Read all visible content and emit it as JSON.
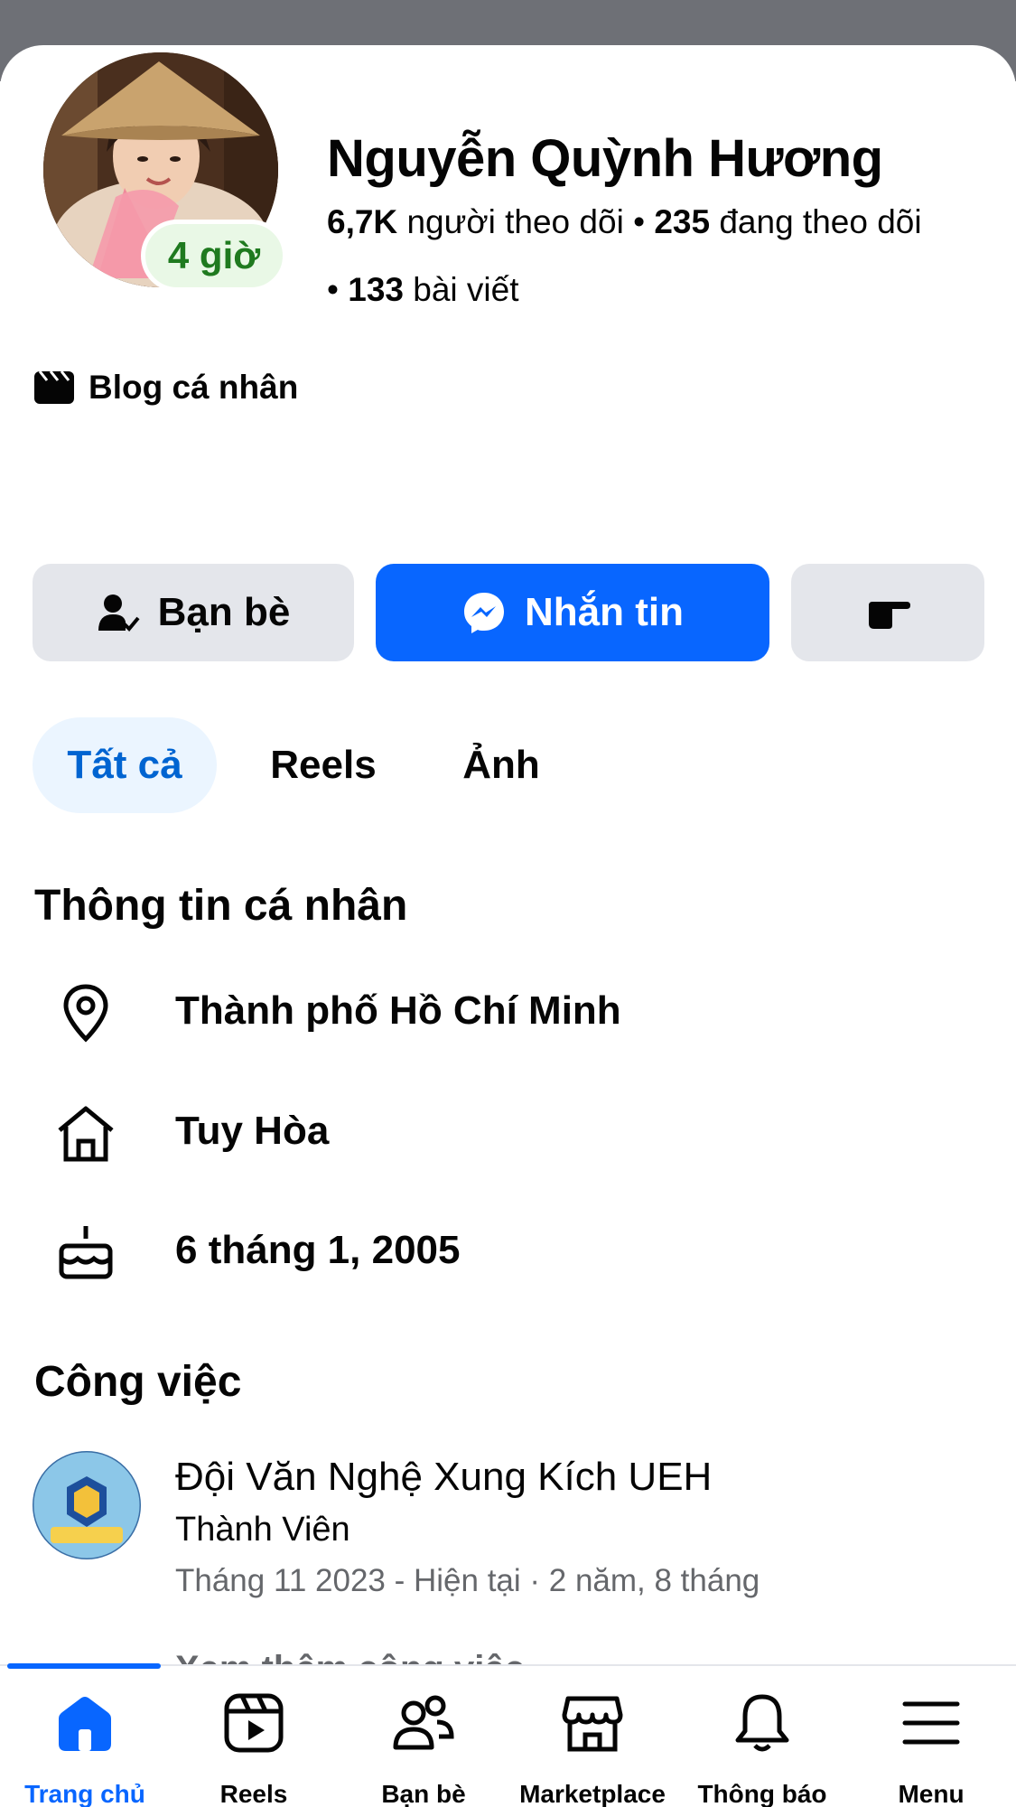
{
  "profile": {
    "name": "Nguyễn Quỳnh Hương",
    "story_badge": "4 giờ",
    "followers_count": "6,7K",
    "followers_label": "người theo dõi",
    "separator": "•",
    "following_count": "235",
    "following_label": "đang theo dõi",
    "posts_count": "133",
    "posts_label": "bài viết",
    "category": "Blog cá nhân"
  },
  "actions": {
    "friends_label": "Bạn bè",
    "message_label": "Nhắn tin",
    "more_icon": "poke-hand-icon"
  },
  "tabs": [
    {
      "label": "Tất cả",
      "active": true
    },
    {
      "label": "Reels",
      "active": false
    },
    {
      "label": "Ảnh",
      "active": false
    }
  ],
  "personal_info": {
    "title": "Thông tin cá nhân",
    "current_city": "Thành phố Hồ Chí Minh",
    "hometown": "Tuy Hòa",
    "birthday": "6 tháng 1, 2005"
  },
  "work": {
    "title": "Công việc",
    "org": "Đội Văn Nghệ Xung Kích UEH",
    "role": "Thành Viên",
    "period": "Tháng 11 2023 - Hiện tại · 2 năm, 8 tháng",
    "see_more": "Xem thêm công việc"
  },
  "bottom_nav": [
    {
      "label": "Trang chủ",
      "icon": "home-icon",
      "active": true
    },
    {
      "label": "Reels",
      "icon": "reels-icon",
      "active": false
    },
    {
      "label": "Bạn bè",
      "icon": "friends-icon",
      "active": false
    },
    {
      "label": "Marketplace",
      "icon": "marketplace-icon",
      "active": false
    },
    {
      "label": "Thông báo",
      "icon": "bell-icon",
      "active": false
    },
    {
      "label": "Menu",
      "icon": "menu-icon",
      "active": false
    }
  ],
  "colors": {
    "primary": "#0866ff",
    "button_gray": "#e4e6eb",
    "active_tab_bg": "#ebf5ff",
    "active_tab_text": "#0064d1",
    "story_badge_bg": "#e9f8e6",
    "story_badge_text": "#1f7a1f",
    "secondary_text": "#65676b"
  }
}
